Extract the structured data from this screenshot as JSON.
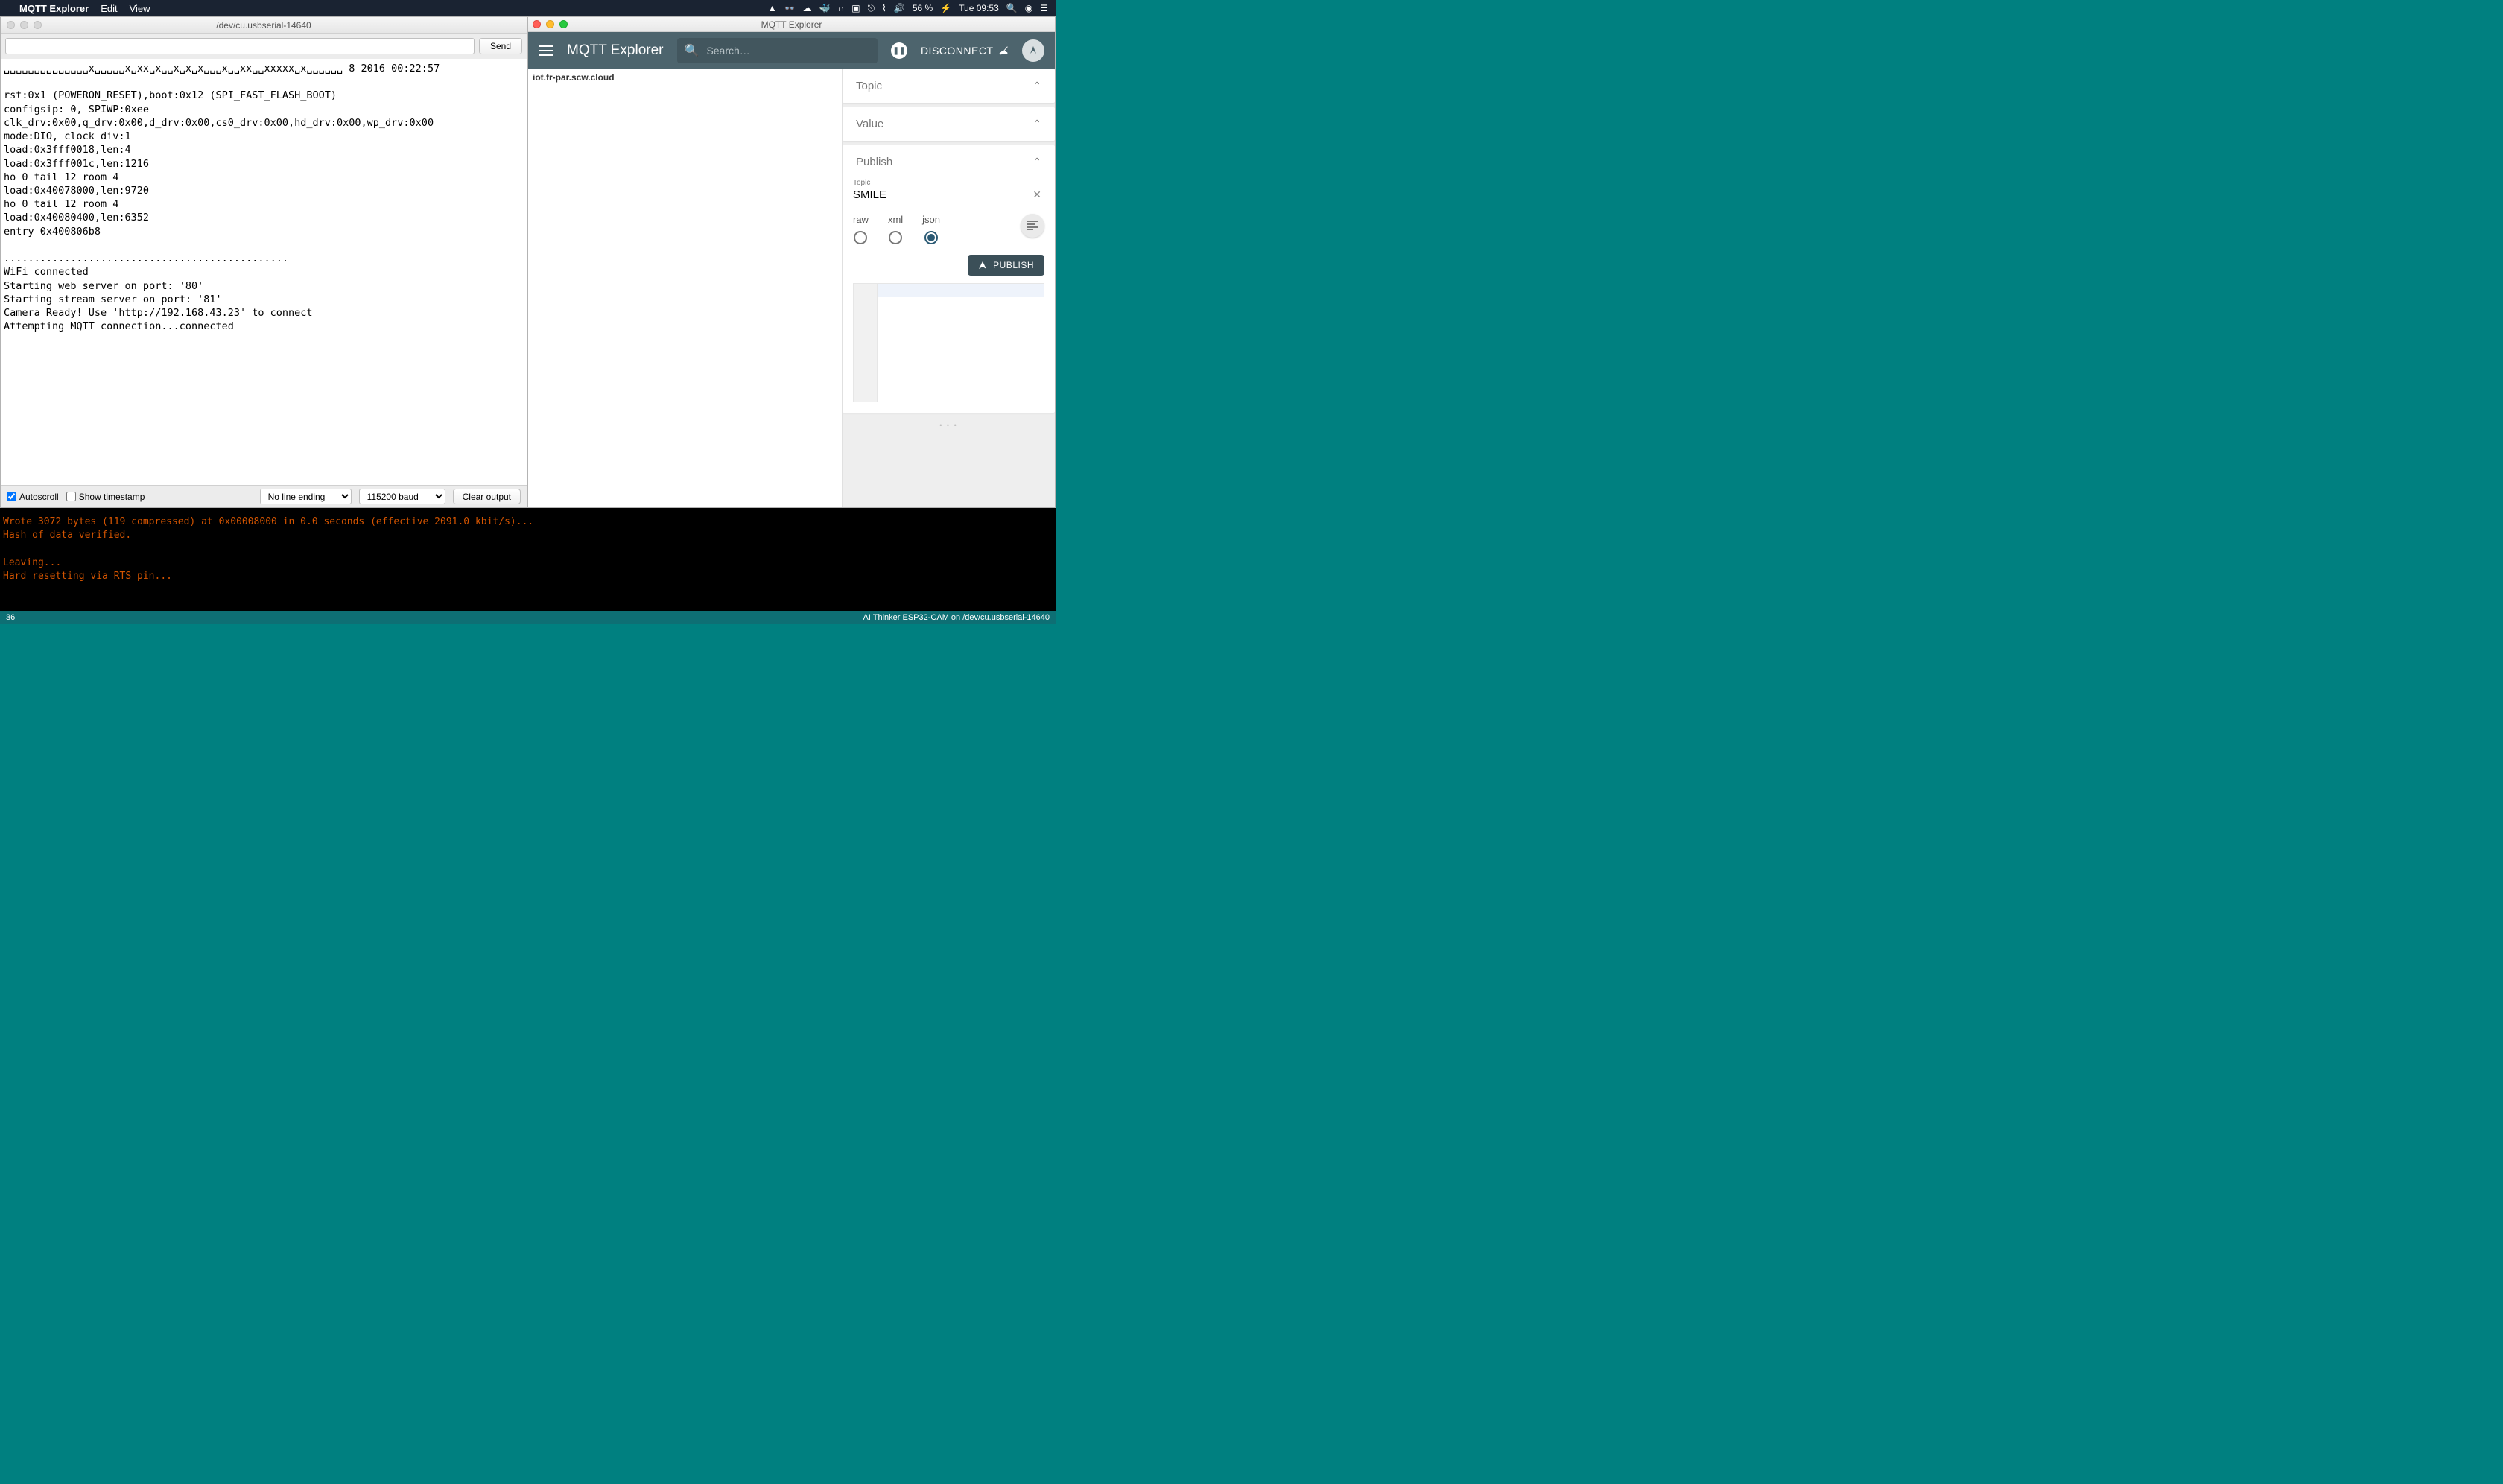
{
  "menubar": {
    "app": "MQTT Explorer",
    "items": [
      "Edit",
      "View"
    ],
    "battery": "56 %",
    "clock": "Tue 09:53"
  },
  "serial": {
    "title": "/dev/cu.usbserial-14640",
    "send": "Send",
    "output": "␣␣␣␣␣␣␣␣␣␣␣␣␣␣x␣␣␣␣␣x␣xx␣x␣␣x␣x␣x␣␣␣x␣␣xx␣␣xxxxx␣x␣␣␣␣␣␣ 8 2016 00:22:57\n\nrst:0x1 (POWERON_RESET),boot:0x12 (SPI_FAST_FLASH_BOOT)\nconfigsip: 0, SPIWP:0xee\nclk_drv:0x00,q_drv:0x00,d_drv:0x00,cs0_drv:0x00,hd_drv:0x00,wp_drv:0x00\nmode:DIO, clock div:1\nload:0x3fff0018,len:4\nload:0x3fff001c,len:1216\nho 0 tail 12 room 4\nload:0x40078000,len:9720\nho 0 tail 12 room 4\nload:0x40080400,len:6352\nentry 0x400806b8\n\n...............................................\nWiFi connected\nStarting web server on port: '80'\nStarting stream server on port: '81'\nCamera Ready! Use 'http://192.168.43.23' to connect\nAttempting MQTT connection...connected",
    "autoscroll": "Autoscroll",
    "showts": "Show timestamp",
    "lineending": "No line ending",
    "baud": "115200 baud",
    "clear": "Clear output"
  },
  "mqtt": {
    "title": "MQTT Explorer",
    "appTitle": "MQTT Explorer",
    "searchPlaceholder": "Search…",
    "disconnect": "DISCONNECT",
    "broker": "iot.fr-par.scw.cloud",
    "sections": {
      "topic": "Topic",
      "value": "Value",
      "publish": "Publish"
    },
    "publish": {
      "topicLabel": "Topic",
      "topicValue": "SMILE",
      "formats": {
        "raw": "raw",
        "xml": "xml",
        "json": "json"
      },
      "selectedFormat": "json",
      "button": "PUBLISH"
    }
  },
  "terminal": {
    "lines": "Wrote 3072 bytes (119 compressed) at 0x00008000 in 0.0 seconds (effective 2091.0 kbit/s)...\nHash of data verified.\n\nLeaving...\nHard resetting via RTS pin..."
  },
  "statusbar": {
    "left": "36",
    "right": "AI Thinker ESP32-CAM on /dev/cu.usbserial-14640"
  }
}
